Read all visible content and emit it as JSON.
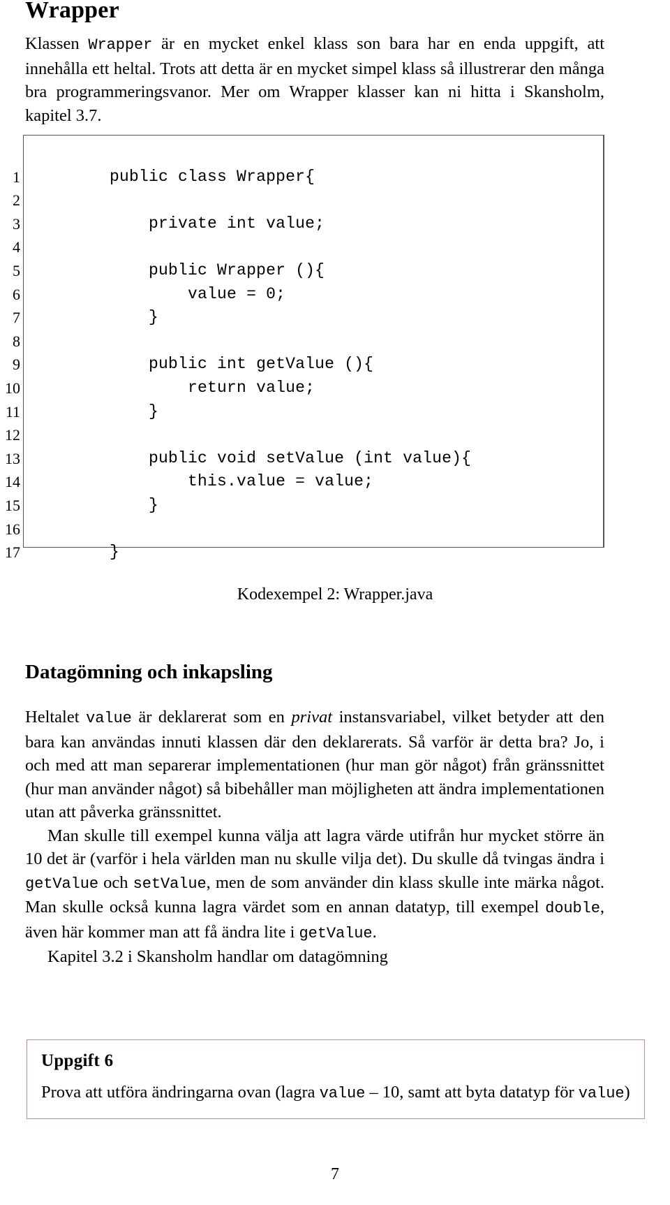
{
  "document": {
    "title": "Wrapper",
    "page_number": "7"
  },
  "intro": {
    "part1": "Klassen ",
    "code1": "Wrapper",
    "part2": " är en mycket enkel klass son bara har en enda uppgift, att innehålla ett heltal. Trots att detta är en mycket simpel klass så illustrerar den många bra programmeringsvanor. Mer om Wrapper klasser kan ni hitta i Skansholm, kapitel 3.7."
  },
  "listing": {
    "caption": "Kodexempel 2: Wrapper.java",
    "lines": [
      {
        "n": "1",
        "code": "public class Wrapper{"
      },
      {
        "n": "2",
        "code": ""
      },
      {
        "n": "3",
        "code": "    private int value;"
      },
      {
        "n": "4",
        "code": ""
      },
      {
        "n": "5",
        "code": "    public Wrapper (){"
      },
      {
        "n": "6",
        "code": "        value = 0;"
      },
      {
        "n": "7",
        "code": "    }"
      },
      {
        "n": "8",
        "code": ""
      },
      {
        "n": "9",
        "code": "    public int getValue (){"
      },
      {
        "n": "10",
        "code": "        return value;"
      },
      {
        "n": "11",
        "code": "    }"
      },
      {
        "n": "12",
        "code": ""
      },
      {
        "n": "13",
        "code": "    public void setValue (int value){"
      },
      {
        "n": "14",
        "code": "        this.value = value;"
      },
      {
        "n": "15",
        "code": "    }"
      },
      {
        "n": "16",
        "code": ""
      },
      {
        "n": "17",
        "code": "}"
      }
    ]
  },
  "section": {
    "heading": "Datagömning och inkapsling",
    "paragraph1": {
      "t1": "Heltalet ",
      "c1": "value",
      "t2": " är deklarerat som en ",
      "i1": "privat",
      "t3": " instansvariabel, vilket betyder att den bara kan användas innuti klassen där den deklarerats. Så varför är detta bra? Jo, i och med att man separerar implementationen (hur man gör något) från gränssnittet (hur man använder något) så bibehåller man möjligheten att ändra implementationen utan att påverka gränssnittet."
    },
    "paragraph2": {
      "t1": "Man skulle till exempel kunna välja att lagra värde utifrån hur mycket större än 10 det är (varför i hela världen man nu skulle vilja det). Du skulle då tvingas ändra i ",
      "c1": "getValue",
      "t2": " och ",
      "c2": "setValue",
      "t3": ", men de som använder din klass skulle inte märka något. Man skulle också kunna lagra värdet som en annan datatyp, till exempel ",
      "c3": "double",
      "t4": ", även här kommer man att få ändra lite i ",
      "c4": "getValue",
      "t5": "."
    },
    "paragraph3": {
      "t1": "Kapitel 3.2 i Skansholm handlar om datagömning"
    }
  },
  "uppgift": {
    "title": "Uppgift 6",
    "body": {
      "t1": "Prova att utföra ändringarna ovan (lagra ",
      "c1": "value",
      "t2": " – 10, samt att byta datatyp för ",
      "c2": "value",
      "t3": ")"
    },
    "border_color": "#c08a8a"
  }
}
